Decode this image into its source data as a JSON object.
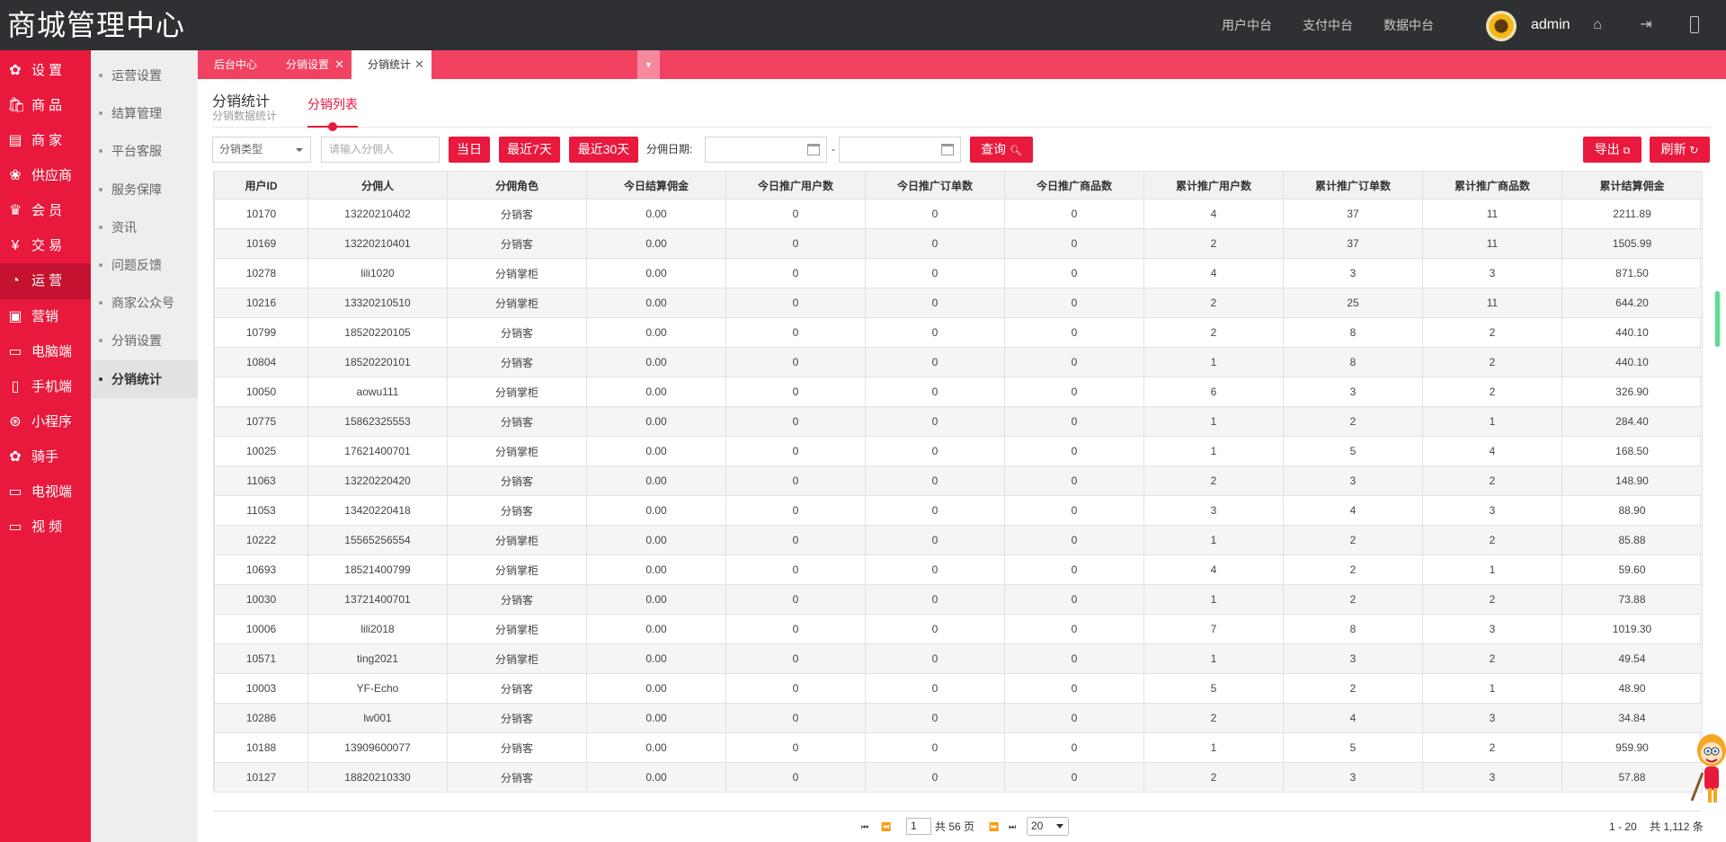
{
  "app_title": "商城管理中心",
  "top_nav": [
    "用户中台",
    "支付中台",
    "数据中台"
  ],
  "user": {
    "name": "admin"
  },
  "top_icons": [
    "home-icon",
    "logout-icon",
    "phone-icon"
  ],
  "sidebar": [
    {
      "label": "设 置",
      "icon": "gear-icon",
      "glyph": "✿"
    },
    {
      "label": "商 品",
      "icon": "basket-icon",
      "glyph": "🛍"
    },
    {
      "label": "商 家",
      "icon": "store-icon",
      "glyph": "▤"
    },
    {
      "label": "供应商",
      "icon": "supplier-icon",
      "glyph": "❀"
    },
    {
      "label": "会 员",
      "icon": "crown-icon",
      "glyph": "♛"
    },
    {
      "label": "交 易",
      "icon": "yen-icon",
      "glyph": "¥"
    },
    {
      "label": "运 营",
      "icon": "pie-chart-icon",
      "glyph": "◔",
      "active": true
    },
    {
      "label": "营销",
      "icon": "marketing-icon",
      "glyph": "▣"
    },
    {
      "label": "电脑端",
      "icon": "desktop-icon",
      "glyph": "▭"
    },
    {
      "label": "手机端",
      "icon": "mobile-icon",
      "glyph": "▯"
    },
    {
      "label": "小程序",
      "icon": "mini-program-icon",
      "glyph": "⊛"
    },
    {
      "label": "骑手",
      "icon": "rider-gear-icon",
      "glyph": "✿"
    },
    {
      "label": "电视端",
      "icon": "tv-icon",
      "glyph": "▭"
    },
    {
      "label": "视 频",
      "icon": "video-icon",
      "glyph": "▭"
    }
  ],
  "subnav": [
    {
      "label": "运营设置"
    },
    {
      "label": "结算管理"
    },
    {
      "label": "平台客服"
    },
    {
      "label": "服务保障"
    },
    {
      "label": "资讯"
    },
    {
      "label": "问题反馈"
    },
    {
      "label": "商家公众号"
    },
    {
      "label": "分销设置"
    },
    {
      "label": "分销统计",
      "active": true
    }
  ],
  "tabs": [
    {
      "label": "后台中心",
      "closable": false
    },
    {
      "label": "分销设置",
      "closable": true
    },
    {
      "label": "分销统计",
      "closable": true,
      "active": true
    }
  ],
  "page": {
    "title": "分销统计",
    "subtitle": "分销数据统计",
    "tab_label": "分销列表"
  },
  "filters": {
    "type_select": "分销类型",
    "name_placeholder": "请输入分佣人",
    "btn_today": "当日",
    "btn_7days": "最近7天",
    "btn_30days": "最近30天",
    "date_label": "分佣日期:",
    "date_sep": "-",
    "btn_query": "查询",
    "btn_export": "导出",
    "btn_refresh": "刷新"
  },
  "table": {
    "columns": [
      "用户ID",
      "分佣人",
      "分佣角色",
      "今日结算佣金",
      "今日推广用户数",
      "今日推广订单数",
      "今日推广商品数",
      "累计推广用户数",
      "累计推广订单数",
      "累计推广商品数",
      "累计结算佣金"
    ],
    "rows": [
      [
        "10170",
        "13220210402",
        "分销客",
        "0.00",
        "0",
        "0",
        "0",
        "4",
        "37",
        "11",
        "2211.89"
      ],
      [
        "10169",
        "13220210401",
        "分销客",
        "0.00",
        "0",
        "0",
        "0",
        "2",
        "37",
        "11",
        "1505.99"
      ],
      [
        "10278",
        "lili1020",
        "分销掌柜",
        "0.00",
        "0",
        "0",
        "0",
        "4",
        "3",
        "3",
        "871.50"
      ],
      [
        "10216",
        "13320210510",
        "分销掌柜",
        "0.00",
        "0",
        "0",
        "0",
        "2",
        "25",
        "11",
        "644.20"
      ],
      [
        "10799",
        "18520220105",
        "分销客",
        "0.00",
        "0",
        "0",
        "0",
        "2",
        "8",
        "2",
        "440.10"
      ],
      [
        "10804",
        "18520220101",
        "分销客",
        "0.00",
        "0",
        "0",
        "0",
        "1",
        "8",
        "2",
        "440.10"
      ],
      [
        "10050",
        "aowu111",
        "分销掌柜",
        "0.00",
        "0",
        "0",
        "0",
        "6",
        "3",
        "2",
        "326.90"
      ],
      [
        "10775",
        "15862325553",
        "分销客",
        "0.00",
        "0",
        "0",
        "0",
        "1",
        "2",
        "1",
        "284.40"
      ],
      [
        "10025",
        "17621400701",
        "分销掌柜",
        "0.00",
        "0",
        "0",
        "0",
        "1",
        "5",
        "4",
        "168.50"
      ],
      [
        "11063",
        "13220220420",
        "分销客",
        "0.00",
        "0",
        "0",
        "0",
        "2",
        "3",
        "2",
        "148.90"
      ],
      [
        "11053",
        "13420220418",
        "分销客",
        "0.00",
        "0",
        "0",
        "0",
        "3",
        "4",
        "3",
        "88.90"
      ],
      [
        "10222",
        "15565256554",
        "分销掌柜",
        "0.00",
        "0",
        "0",
        "0",
        "1",
        "2",
        "2",
        "85.88"
      ],
      [
        "10693",
        "18521400799",
        "分销掌柜",
        "0.00",
        "0",
        "0",
        "0",
        "4",
        "2",
        "1",
        "59.60"
      ],
      [
        "10030",
        "13721400701",
        "分销客",
        "0.00",
        "0",
        "0",
        "0",
        "1",
        "2",
        "2",
        "73.88"
      ],
      [
        "10006",
        "lili2018",
        "分销掌柜",
        "0.00",
        "0",
        "0",
        "0",
        "7",
        "8",
        "3",
        "1019.30"
      ],
      [
        "10571",
        "ting2021",
        "分销掌柜",
        "0.00",
        "0",
        "0",
        "0",
        "1",
        "3",
        "2",
        "49.54"
      ],
      [
        "10003",
        "YF-Echo",
        "分销客",
        "0.00",
        "0",
        "0",
        "0",
        "5",
        "2",
        "1",
        "48.90"
      ],
      [
        "10286",
        "lw001",
        "分销客",
        "0.00",
        "0",
        "0",
        "0",
        "2",
        "4",
        "3",
        "34.84"
      ],
      [
        "10188",
        "13909600077",
        "分销客",
        "0.00",
        "0",
        "0",
        "0",
        "1",
        "5",
        "2",
        "959.90"
      ],
      [
        "10127",
        "18820210330",
        "分销客",
        "0.00",
        "0",
        "0",
        "0",
        "2",
        "3",
        "3",
        "57.88"
      ]
    ]
  },
  "pager": {
    "first": "⏮",
    "prev": "⏪",
    "page": "1",
    "total_pages": "共 56 页",
    "next": "⏩",
    "last": "⏭",
    "page_size": "20",
    "range": "1 - 20",
    "total": "共 1,112 条"
  },
  "colors": {
    "brand_red": "#e8193c",
    "tab_strip": "#f24262",
    "topbar": "#2f3033"
  }
}
